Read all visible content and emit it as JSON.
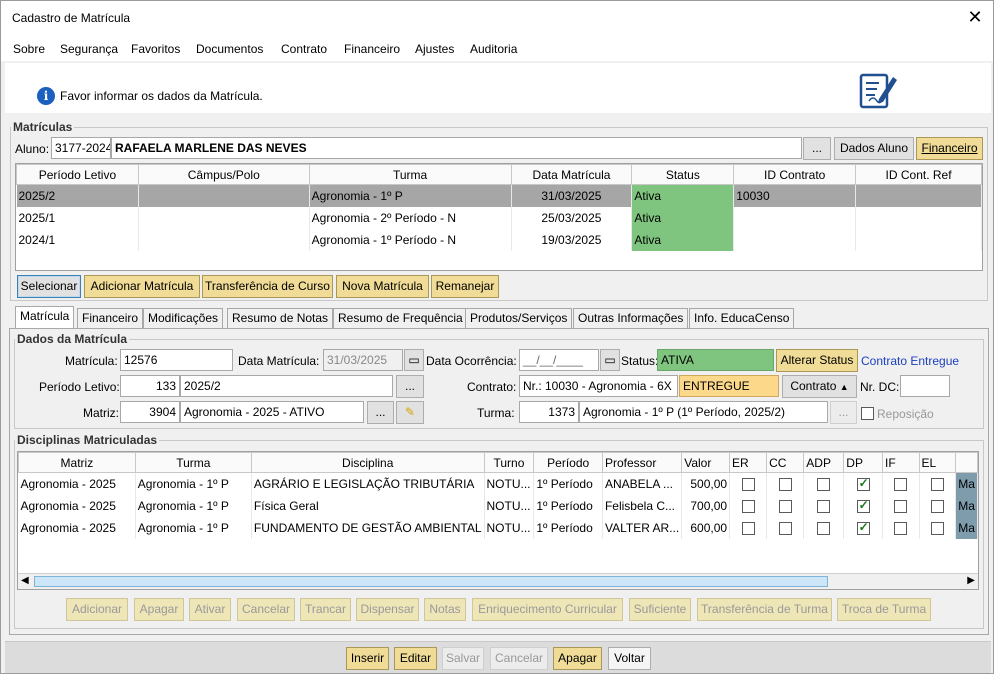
{
  "window": {
    "title": "Cadastro de Matrícula"
  },
  "menu": [
    "Sobre",
    "Segurança",
    "Favoritos",
    "Documentos",
    "Contrato",
    "Financeiro",
    "Ajustes",
    "Auditoria"
  ],
  "info": {
    "message": "Favor informar os dados da Matrícula."
  },
  "matriculas": {
    "legend": "Matrículas",
    "aluno_label": "Aluno:",
    "aluno_code": "3177-2024",
    "aluno_name": "RAFAELA MARLENE DAS NEVES",
    "ellipsis": "...",
    "dados_aluno": "Dados Aluno",
    "financeiro": "Financeiro",
    "columns": [
      "Período Letivo",
      "Câmpus/Polo",
      "Turma",
      "Data Matrícula",
      "Status",
      "ID Contrato",
      "ID Cont. Ref"
    ],
    "rows": [
      {
        "periodo": "2025/2",
        "campus": "",
        "turma": "Agronomia - 1º P",
        "data": "31/03/2025",
        "status": "Ativa",
        "id_contrato": "10030",
        "id_ref": ""
      },
      {
        "periodo": "2025/1",
        "campus": "",
        "turma": "Agronomia - 2º Período - N",
        "data": "25/03/2025",
        "status": "Ativa",
        "id_contrato": "",
        "id_ref": ""
      },
      {
        "periodo": "2024/1",
        "campus": "",
        "turma": "Agronomia - 1º Período - N",
        "data": "19/03/2025",
        "status": "Ativa",
        "id_contrato": "",
        "id_ref": ""
      }
    ],
    "buttons": [
      "Selecionar",
      "Adicionar Matrícula",
      "Transferência de Curso",
      "Nova Matrícula",
      "Remanejar"
    ]
  },
  "tabs": [
    "Matrícula",
    "Financeiro",
    "Modificações",
    "Resumo de Notas",
    "Resumo de Frequência",
    "Produtos/Serviços",
    "Outras Informações",
    "Info. EducaCenso"
  ],
  "dados": {
    "legend": "Dados da Matrícula",
    "matricula_label": "Matrícula:",
    "matricula": "12576",
    "data_matricula_label": "Data Matrícula:",
    "data_matricula": "31/03/2025",
    "data_ocorrencia_label": "Data Ocorrência:",
    "data_ocorrencia": "__/__/____",
    "status_label": "Status:",
    "status": "ATIVA",
    "alterar_status": "Alterar Status",
    "contrato_entregue": "Contrato Entregue",
    "periodo_label": "Período Letivo:",
    "periodo_code": "133",
    "periodo": "2025/2",
    "contrato_label": "Contrato:",
    "contrato": "Nr.: 10030 - Agronomia - 6X",
    "entregue": "ENTREGUE",
    "contrato_btn": "Contrato",
    "nr_dc_label": "Nr. DC:",
    "nr_dc": "",
    "matriz_label": "Matriz:",
    "matriz_code": "3904",
    "matriz": "Agronomia - 2025 - ATIVO",
    "turma_label": "Turma:",
    "turma_code": "1373",
    "turma": "Agronomia - 1º P (1º Período, 2025/2)",
    "reposicao": "Reposição"
  },
  "disciplinas": {
    "legend": "Disciplinas Matriculadas",
    "columns": [
      "Matriz",
      "Turma",
      "Disciplina",
      "Turno",
      "Período",
      "Professor",
      "Valor",
      "ER",
      "CC",
      "ADP",
      "DP",
      "IF",
      "EL",
      ""
    ],
    "rows": [
      {
        "matriz": "Agronomia - 2025",
        "turma": "Agronomia - 1º P",
        "disciplina": "AGRÁRIO E LEGISLAÇÃO TRIBUTÁRIA",
        "turno": "NOTU...",
        "periodo": "1º Período",
        "professor": "ANABELA ...",
        "valor": "500,00",
        "dp": true,
        "extra": "Ma"
      },
      {
        "matriz": "Agronomia - 2025",
        "turma": "Agronomia - 1º P",
        "disciplina": "Física Geral",
        "turno": "NOTU...",
        "periodo": "1º Período",
        "professor": "Felisbela C...",
        "valor": "700,00",
        "dp": true,
        "extra": "Ma"
      },
      {
        "matriz": "Agronomia - 2025",
        "turma": "Agronomia - 1º P",
        "disciplina": "FUNDAMENTO DE GESTÃO AMBIENTAL",
        "turno": "NOTU...",
        "periodo": "1º Período",
        "professor": "VALTER AR...",
        "valor": "600,00",
        "dp": true,
        "extra": "Ma"
      }
    ],
    "buttons": [
      "Adicionar",
      "Apagar",
      "Ativar",
      "Cancelar",
      "Trancar",
      "Dispensar",
      "Notas",
      "Enriquecimento Curricular",
      "Suficiente",
      "Transferência de Turma",
      "Troca de Turma"
    ]
  },
  "bottom": {
    "buttons": [
      "Inserir",
      "Editar",
      "Salvar",
      "Cancelar",
      "Apagar",
      "Voltar"
    ]
  },
  "colors": {
    "status_green": "#7fc57f",
    "gold": "#f0dc96",
    "selected_row": "#a6a6a6"
  }
}
